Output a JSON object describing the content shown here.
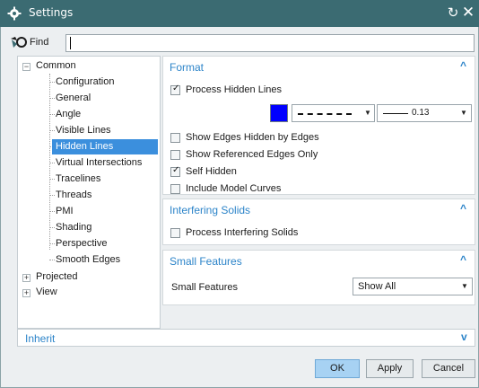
{
  "window": {
    "title": "Settings",
    "controls": {
      "reset": "↻",
      "close": "✕"
    }
  },
  "find": {
    "label": "Find",
    "value": ""
  },
  "tree": {
    "root": [
      {
        "label": "Common",
        "expander": "−",
        "children": [
          "Configuration",
          "General",
          "Angle",
          "Visible Lines",
          "Hidden Lines",
          "Virtual Intersections",
          "Tracelines",
          "Threads",
          "PMI",
          "Shading",
          "Perspective",
          "Smooth Edges"
        ],
        "selected": "Hidden Lines"
      },
      {
        "label": "Projected",
        "expander": "+"
      },
      {
        "label": "View",
        "expander": "+"
      }
    ]
  },
  "format": {
    "header": "Format",
    "process_hidden_lines": {
      "label": "Process Hidden Lines",
      "checked": true
    },
    "color": "#0000ff",
    "line_font": "dashed",
    "line_width": "0.13",
    "show_edges_hidden": {
      "label": "Show Edges Hidden by Edges",
      "checked": false
    },
    "show_referenced": {
      "label": "Show Referenced Edges Only",
      "checked": false
    },
    "self_hidden": {
      "label": "Self Hidden",
      "checked": true
    },
    "include_model_curves": {
      "label": "Include Model Curves",
      "checked": false
    }
  },
  "interfering": {
    "header": "Interfering Solids",
    "process": {
      "label": "Process Interfering Solids",
      "checked": false
    }
  },
  "small_features": {
    "header": "Small Features",
    "label": "Small Features",
    "value": "Show All"
  },
  "inherit": {
    "label": "Inherit"
  },
  "buttons": {
    "ok": "OK",
    "apply": "Apply",
    "cancel": "Cancel"
  },
  "icons": {
    "settings": "gear-icon",
    "find": "find-icon",
    "collapse": "chevron-up-icon",
    "expand": "chevron-down-icon",
    "dropdown": "caret-down-icon"
  },
  "colors": {
    "titlebar": "#3b6b72",
    "accent": "#2c84c9",
    "selection": "#3b8fdd"
  }
}
